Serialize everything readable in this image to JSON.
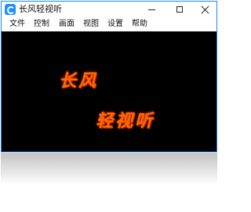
{
  "window": {
    "title": "长风轻视听"
  },
  "menu": {
    "items": [
      "文件",
      "控制",
      "画面",
      "视图",
      "设置",
      "帮助"
    ]
  },
  "video": {
    "logo_line1": "长风",
    "logo_line2": "轻视听"
  },
  "colors": {
    "accent": "#1e90ff",
    "logo": "#ff6a00"
  },
  "icons": [
    "app-logo-icon",
    "minimize-icon",
    "maximize-icon",
    "close-icon"
  ]
}
